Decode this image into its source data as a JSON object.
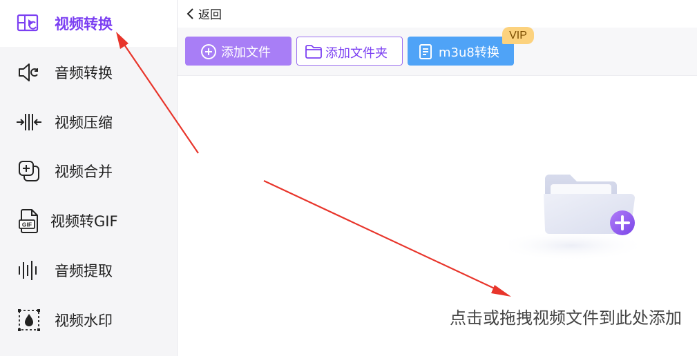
{
  "sidebar": {
    "items": [
      {
        "label": "视频转换",
        "icon": "video-convert-icon",
        "active": true
      },
      {
        "label": "音频转换",
        "icon": "audio-convert-icon"
      },
      {
        "label": "视频压缩",
        "icon": "video-compress-icon"
      },
      {
        "label": "视频合并",
        "icon": "video-merge-icon"
      },
      {
        "label": "视频转GIF",
        "icon": "gif-icon"
      },
      {
        "label": "音频提取",
        "icon": "audio-extract-icon"
      },
      {
        "label": "视频水印",
        "icon": "watermark-icon"
      }
    ]
  },
  "header": {
    "back_label": "返回"
  },
  "toolbar": {
    "add_file_label": "添加文件",
    "add_folder_label": "添加文件夹",
    "m3u8_label": "m3u8转换",
    "vip_badge": "VIP"
  },
  "main": {
    "drop_hint": "点击或拖拽视频文件到此处添加"
  },
  "colors": {
    "accent": "#7b3ff2",
    "add_button": "#a87ef6",
    "m3u8_button": "#4fa3f7",
    "vip_badge": "#fcd27e",
    "annotation_arrow": "#e8352b"
  }
}
